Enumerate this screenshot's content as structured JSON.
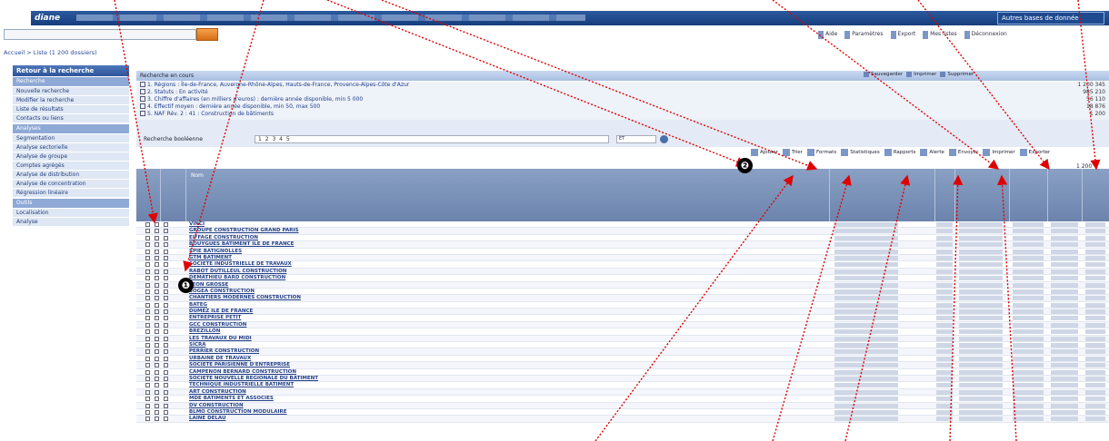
{
  "app": {
    "logo": "diane",
    "account": "Autres bases de donnée"
  },
  "search": {
    "placeholder": ""
  },
  "toolbar_top": [
    "Aide",
    "Paramètres",
    "Export",
    "Mes listes",
    "Déconnexion"
  ],
  "breadcrumb": "Accueil > Liste (1 200 dossiers)",
  "sidebar": {
    "heading": "Retour à la recherche",
    "sections": [
      {
        "title": "Recherche",
        "items": [
          {
            "label": "Nouvelle recherche",
            "count": ""
          },
          {
            "label": "Modifier la recherche",
            "count": ""
          },
          {
            "label": "Liste de résultats",
            "count": ""
          },
          {
            "label": "Contacts ou liens",
            "count": ""
          }
        ]
      },
      {
        "title": "Analyses",
        "items": [
          {
            "label": "Segmentation",
            "count": ""
          },
          {
            "label": "Analyse sectorielle",
            "count": ""
          },
          {
            "label": "Analyse de groupe",
            "count": ""
          },
          {
            "label": "Comptes agrégés",
            "count": ""
          },
          {
            "label": "Analyse de distribution",
            "count": ""
          },
          {
            "label": "Analyse de concentration",
            "count": ""
          },
          {
            "label": "Régression linéaire",
            "count": ""
          }
        ]
      },
      {
        "title": "Outils",
        "items": [
          {
            "label": "Localisation",
            "count": ""
          },
          {
            "label": "Analyse",
            "count": ""
          }
        ]
      }
    ]
  },
  "criteria": {
    "heading": "Recherche en cours",
    "buttons": [
      "Sauvegarder",
      "Imprimer",
      "Supprimer"
    ],
    "rows": [
      {
        "text": "Régions : Île-de-France, Auvergne-Rhône-Alpes, Hauts-de-France, Provence-Alpes-Côte d'Azur",
        "count": "1 200 345"
      },
      {
        "text": "Statuts : En activité",
        "count": "985 210"
      },
      {
        "text": "Chiffre d'affaires (en milliers d'euros) : dernière année disponible, min 5 000",
        "count": "56 110"
      },
      {
        "text": "Effectif moyen : dernière année disponible, min 50, max 500",
        "count": "18 876"
      },
      {
        "text": "NAF Rév. 2 : 41 : Construction de bâtiments",
        "count": "1 200"
      }
    ],
    "field_label": "Recherche booléenne",
    "field_value": "1 2 3 4 5",
    "select_value": "ET"
  },
  "results_toolbar": [
    "Ajouter",
    "Trier",
    "Formats",
    "Statistiques",
    "Rapports",
    "Alerte",
    "Envoyer",
    "Imprimer",
    "Exporter"
  ],
  "results_count": "1 200",
  "grid": {
    "header_name": "Nom",
    "rows": [
      "VINCI",
      "GROUPE CONSTRUCTION GRAND PARIS",
      "EIFFAGE CONSTRUCTION",
      "BOUYGUES BATIMENT ILE DE FRANCE",
      "SPIE BATIGNOLLES",
      "GTM BATIMENT",
      "SOCIETE INDUSTRIELLE DE TRAVAUX",
      "RABOT DUTILLEUL CONSTRUCTION",
      "DEMATHIEU BARD CONSTRUCTION",
      "LEON GROSSE",
      "SOGEA CONSTRUCTION",
      "CHANTIERS MODERNES CONSTRUCTION",
      "BATEG",
      "DUMEZ ILE DE FRANCE",
      "ENTREPRISE PETIT",
      "GCC CONSTRUCTION",
      "BREZILLON",
      "LES TRAVAUX DU MIDI",
      "SICRA",
      "PERRIER CONSTRUCTION",
      "URBAINE DE TRAVAUX",
      "SOCIETE PARISIENNE D'ENTREPRISE",
      "CAMPENON BERNARD CONSTRUCTION",
      "SOCIETE NOUVELLE REGIONALE DU BATIMENT",
      "TECHNIQUE INDUSTRIELLE BATIMENT",
      "ART CONSTRUCTION",
      "MDE BATIMENTS ET ASSOCIES",
      "DV CONSTRUCTION",
      "BLMO CONSTRUCTION MODULAIRE",
      "LAINE DELAU"
    ]
  },
  "callouts": {
    "one": "❶",
    "two": "❷"
  }
}
